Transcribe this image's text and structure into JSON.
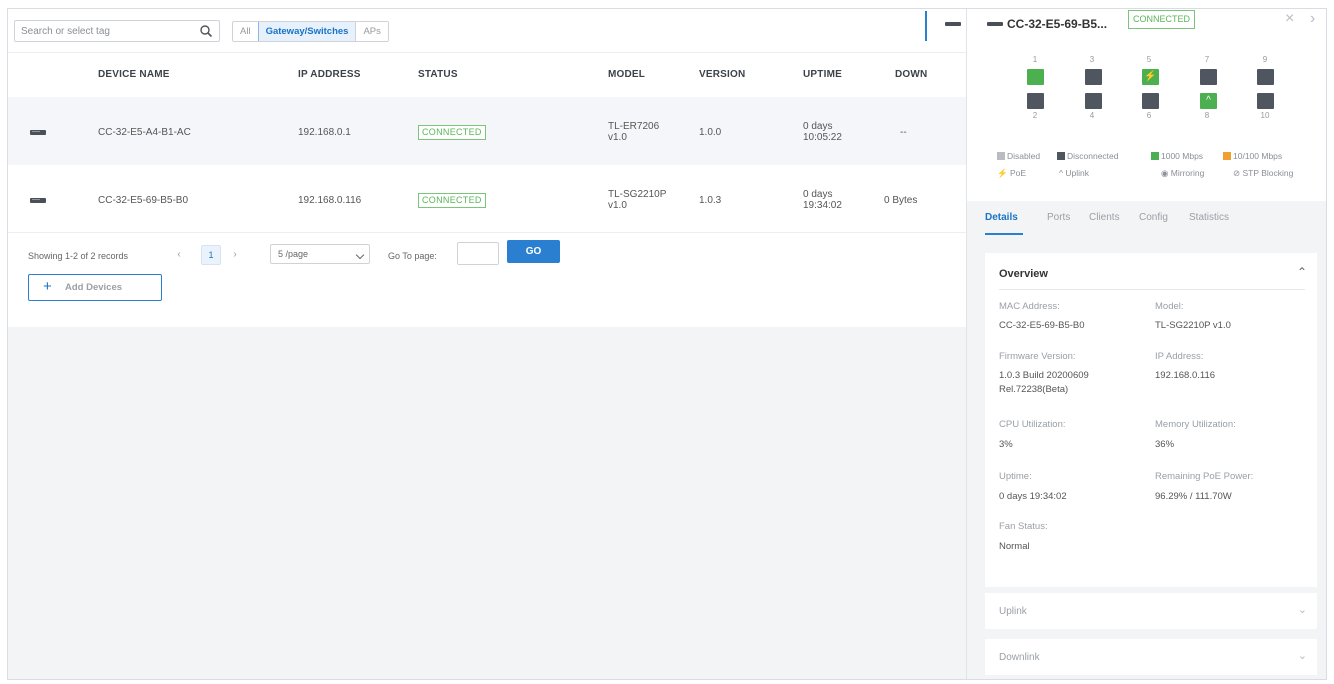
{
  "search": {
    "placeholder": "Search or select tag"
  },
  "tag_filters": [
    "All",
    "Gateway/Switches",
    "APs"
  ],
  "tag_active": "Gateway/Switches",
  "table": {
    "columns": [
      "DEVICE NAME",
      "IP ADDRESS",
      "STATUS",
      "MODEL",
      "VERSION",
      "UPTIME",
      "DOWN"
    ],
    "rows": [
      {
        "name": "CC-32-E5-A4-B1-AC",
        "ip": "192.168.0.1",
        "status": "CONNECTED",
        "model_line1": "TL-ER7206",
        "model_line2": "v1.0",
        "version": "1.0.0",
        "uptime_line1": "0 days",
        "uptime_line2": "10:05:22",
        "down": "--"
      },
      {
        "name": "CC-32-E5-69-B5-B0",
        "ip": "192.168.0.116",
        "status": "CONNECTED",
        "model_line1": "TL-SG2210P",
        "model_line2": "v1.0",
        "version": "1.0.3",
        "uptime_line1": "0 days",
        "uptime_line2": "19:34:02",
        "down": "0 Bytes"
      }
    ]
  },
  "pager": {
    "showing": "Showing 1-2 of 2 records",
    "prev": "‹",
    "page": "1",
    "next": "›",
    "per_page": "5 /page",
    "goto_label": "Go To page:",
    "go": "GO"
  },
  "add_devices": {
    "plus": "+",
    "label": "Add Devices"
  },
  "side": {
    "title": "CC-32-E5-69-B5...",
    "status": "CONNECTED",
    "close": "×",
    "next": "›",
    "port_top_numbers": [
      "1",
      "3",
      "5",
      "7",
      "9"
    ],
    "port_bottom_numbers": [
      "2",
      "4",
      "6",
      "8",
      "10"
    ],
    "legend": {
      "disabled": "Disabled",
      "disconnected": "Disconnected",
      "gbps": "1000 Mbps",
      "mbps": "10/100 Mbps",
      "poe": "PoE",
      "uplink": "Uplink",
      "mirroring": "Mirroring",
      "stp": "STP Blocking"
    },
    "legend_icons": {
      "poe": "⚡",
      "uplink": "^",
      "mirroring": "◉",
      "stp": "⊘"
    },
    "tabs": [
      "Details",
      "Ports",
      "Clients",
      "Config",
      "Statistics"
    ],
    "active_tab": "Details",
    "overview": {
      "title": "Overview",
      "collapse_icon": "⌃",
      "mac_label": "MAC Address:",
      "mac": "CC-32-E5-69-B5-B0",
      "model_label": "Model:",
      "model": "TL-SG2210P v1.0",
      "fw_label": "Firmware Version:",
      "fw_line1": "1.0.3 Build 20200609",
      "fw_line2": "Rel.72238(Beta)",
      "ip_label": "IP Address:",
      "ip": "192.168.0.116",
      "cpu_label": "CPU Utilization:",
      "cpu": "3%",
      "mem_label": "Memory Utilization:",
      "mem": "36%",
      "uptime_label": "Uptime:",
      "uptime": "0 days 19:34:02",
      "poe_label": "Remaining PoE Power:",
      "poe": "96.29% / 111.70W",
      "fan_label": "Fan Status:",
      "fan": "Normal"
    },
    "uplink": "Uplink",
    "downlink": "Downlink",
    "expand_icon": "⌄"
  },
  "colors": {
    "accent": "#2b7fd0",
    "connected": "#5ab55a",
    "port_gray": "#4f5660",
    "port_green": "#4caf50",
    "port_orange": "#f0a030",
    "disabled_gray": "#b9bdc2"
  }
}
